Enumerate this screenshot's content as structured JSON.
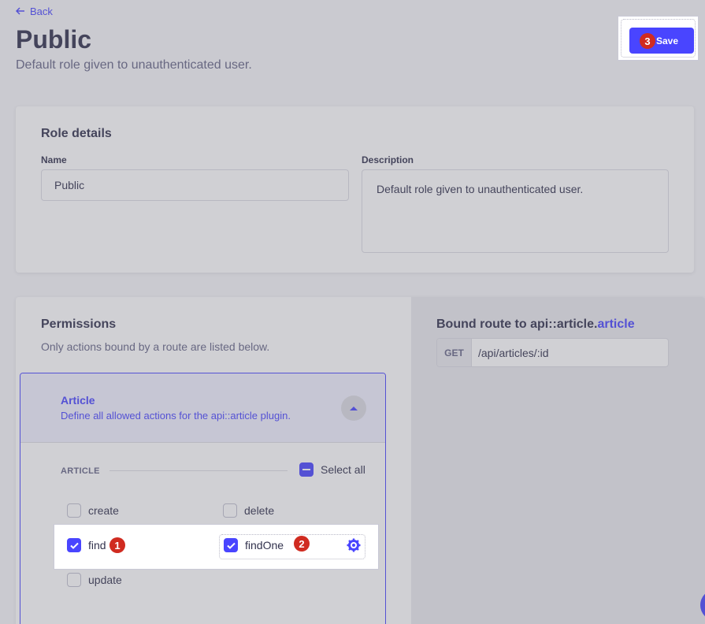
{
  "header": {
    "back_label": "Back",
    "title": "Public",
    "subtitle": "Default role given to unauthenticated user.",
    "save_label": "Save"
  },
  "role_details": {
    "heading": "Role details",
    "name_label": "Name",
    "name_value": "Public",
    "description_label": "Description",
    "description_value": "Default role given to unauthenticated user."
  },
  "permissions": {
    "heading": "Permissions",
    "subtitle": "Only actions bound by a route are listed below.",
    "accordion": {
      "title": "Article",
      "description": "Define all allowed actions for the api::article plugin.",
      "section_label": "ARTICLE",
      "select_all_label": "Select all",
      "actions": [
        {
          "label": "create",
          "checked": false
        },
        {
          "label": "delete",
          "checked": false
        },
        {
          "label": "find",
          "checked": true
        },
        {
          "label": "findOne",
          "checked": true
        },
        {
          "label": "update",
          "checked": false
        }
      ]
    }
  },
  "bound_route": {
    "heading_prefix": "Bound route to api::article.",
    "heading_highlight": "article",
    "method": "GET",
    "path": "/api/articles/:id"
  },
  "annotations": {
    "badge_1": "1",
    "badge_2": "2",
    "badge_3": "3"
  },
  "colors": {
    "primary": "#4945ff",
    "badge": "#d02b20",
    "text": "#32324d",
    "muted": "#666687"
  }
}
